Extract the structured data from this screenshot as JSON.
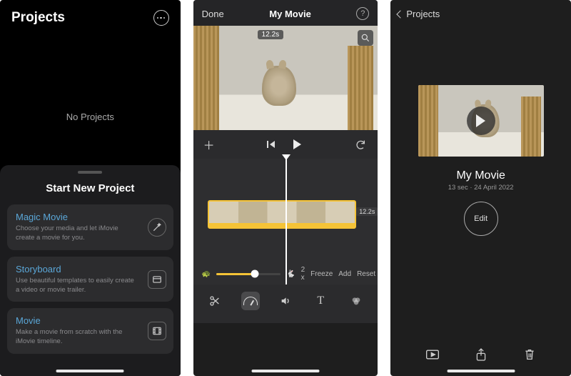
{
  "projects_screen": {
    "title": "Projects",
    "empty_text": "No Projects",
    "sheet_title": "Start New Project",
    "options": [
      {
        "title": "Magic Movie",
        "desc": "Choose your media and let iMovie create a movie for you.",
        "icon": "magic-wand-icon"
      },
      {
        "title": "Storyboard",
        "desc": "Use beautiful templates to easily create a video or movie trailer.",
        "icon": "storyboard-icon"
      },
      {
        "title": "Movie",
        "desc": "Make a movie from scratch with the iMovie timeline.",
        "icon": "film-icon"
      }
    ]
  },
  "editor_screen": {
    "done_label": "Done",
    "title": "My Movie",
    "duration_badge": "12.2s",
    "clip_duration": "12.2s",
    "speed_label": "2 x",
    "speed_buttons": {
      "freeze": "Freeze",
      "add": "Add",
      "reset": "Reset"
    }
  },
  "details_screen": {
    "back_label": "Projects",
    "movie_title": "My Movie",
    "meta": "13 sec · 24 April 2022",
    "edit_label": "Edit"
  }
}
